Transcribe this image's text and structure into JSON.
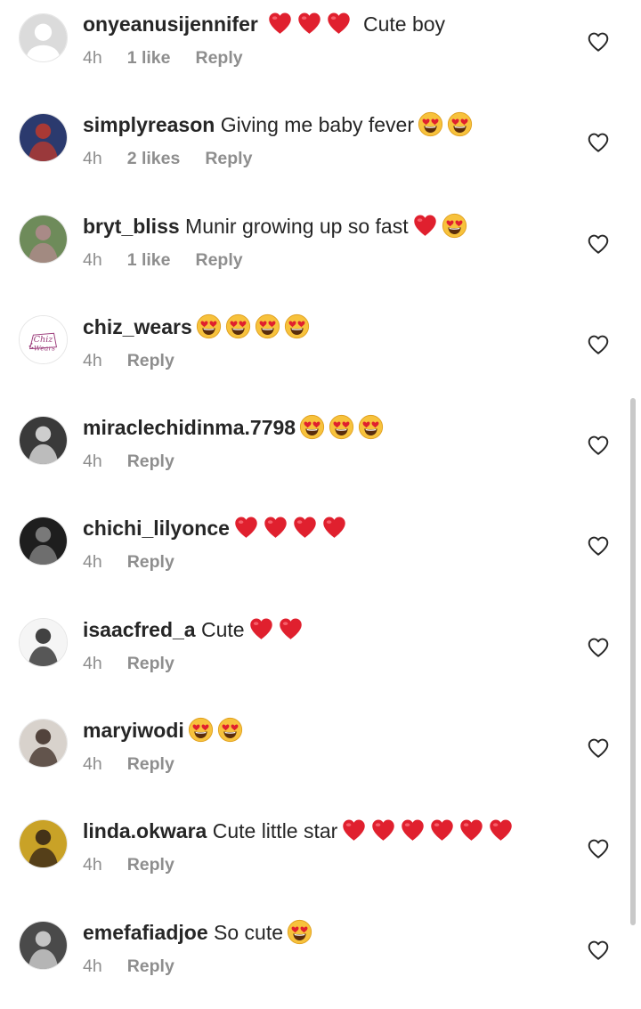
{
  "comments": [
    {
      "username": "onyeanusijennifer",
      "text": "Cute boy",
      "emojis": [
        "heart",
        "heart",
        "heart"
      ],
      "emoji_position": "before",
      "time": "4h",
      "likes": "1 like",
      "reply": "Reply",
      "avatar": "grey-default",
      "avatar_colors": [
        "#dbdbdb",
        "#ffffff"
      ]
    },
    {
      "username": "simplyreason",
      "text": "Giving me baby fever",
      "emojis": [
        "heart-eyes",
        "heart-eyes"
      ],
      "emoji_position": "after",
      "time": "4h",
      "likes": "2 likes",
      "reply": "Reply",
      "avatar": "photo",
      "avatar_colors": [
        "#2b3a6e",
        "#c0392b"
      ]
    },
    {
      "username": "bryt_bliss",
      "text": "Munir growing up so fast",
      "emojis": [
        "heart",
        "heart-eyes"
      ],
      "emoji_position": "after",
      "time": "4h",
      "likes": "1 like",
      "reply": "Reply",
      "avatar": "photo",
      "avatar_colors": [
        "#6e8b5a",
        "#b48a8f"
      ]
    },
    {
      "username": "chiz_wears",
      "text": "",
      "emojis": [
        "heart-eyes",
        "heart-eyes",
        "heart-eyes",
        "heart-eyes"
      ],
      "emoji_position": "after",
      "time": "4h",
      "likes": "",
      "reply": "Reply",
      "avatar": "logo",
      "avatar_colors": [
        "#ffffff",
        "#9b3b7a"
      ],
      "avatar_logo_line1": "Chiz",
      "avatar_logo_line2": "Wears"
    },
    {
      "username": "miraclechidinma.7798",
      "text": "",
      "emojis": [
        "heart-eyes",
        "heart-eyes",
        "heart-eyes"
      ],
      "emoji_position": "after",
      "time": "4h",
      "likes": "",
      "reply": "Reply",
      "avatar": "photo",
      "avatar_colors": [
        "#3a3a3a",
        "#e8e8e8"
      ]
    },
    {
      "username": "chichi_lilyonce",
      "text": "",
      "emojis": [
        "heart",
        "heart",
        "heart",
        "heart"
      ],
      "emoji_position": "after",
      "time": "4h",
      "likes": "",
      "reply": "Reply",
      "avatar": "photo",
      "avatar_colors": [
        "#1e1e1e",
        "#8a8a8a"
      ]
    },
    {
      "username": "isaacfred_a",
      "text": "Cute",
      "emojis": [
        "heart",
        "heart"
      ],
      "emoji_position": "after",
      "time": "4h",
      "likes": "",
      "reply": "Reply",
      "avatar": "photo",
      "avatar_colors": [
        "#f5f5f5",
        "#222222"
      ]
    },
    {
      "username": "maryiwodi",
      "text": "",
      "emojis": [
        "heart-eyes",
        "heart-eyes"
      ],
      "emoji_position": "after",
      "time": "4h",
      "likes": "",
      "reply": "Reply",
      "avatar": "photo",
      "avatar_colors": [
        "#d8d2cc",
        "#3b2a22"
      ]
    },
    {
      "username": "linda.okwara",
      "text": "Cute little star",
      "emojis": [
        "heart",
        "heart",
        "heart",
        "heart",
        "heart",
        "heart"
      ],
      "emoji_position": "after",
      "time": "4h",
      "likes": "",
      "reply": "Reply",
      "avatar": "photo",
      "avatar_colors": [
        "#c9a227",
        "#2d1e16"
      ]
    },
    {
      "username": "emefafiadjoe",
      "text": "So cute",
      "emojis": [
        "heart-eyes"
      ],
      "emoji_position": "after",
      "time": "4h",
      "likes": "",
      "reply": "Reply",
      "avatar": "photo",
      "avatar_colors": [
        "#4a4a4a",
        "#d9d9d9"
      ]
    }
  ],
  "colors": {
    "username": "#262626",
    "text": "#262626",
    "meta": "#8e8e8e",
    "heart_emoji": "#e0202e",
    "emoji_face": "#f7c23c",
    "like_icon_stroke": "#262626",
    "scrollbar": "#c9c9c9"
  },
  "icons": {
    "like_button": "heart-outline-icon",
    "heart_emoji": "red-heart-emoji",
    "heart_eyes_emoji": "heart-eyes-emoji"
  }
}
